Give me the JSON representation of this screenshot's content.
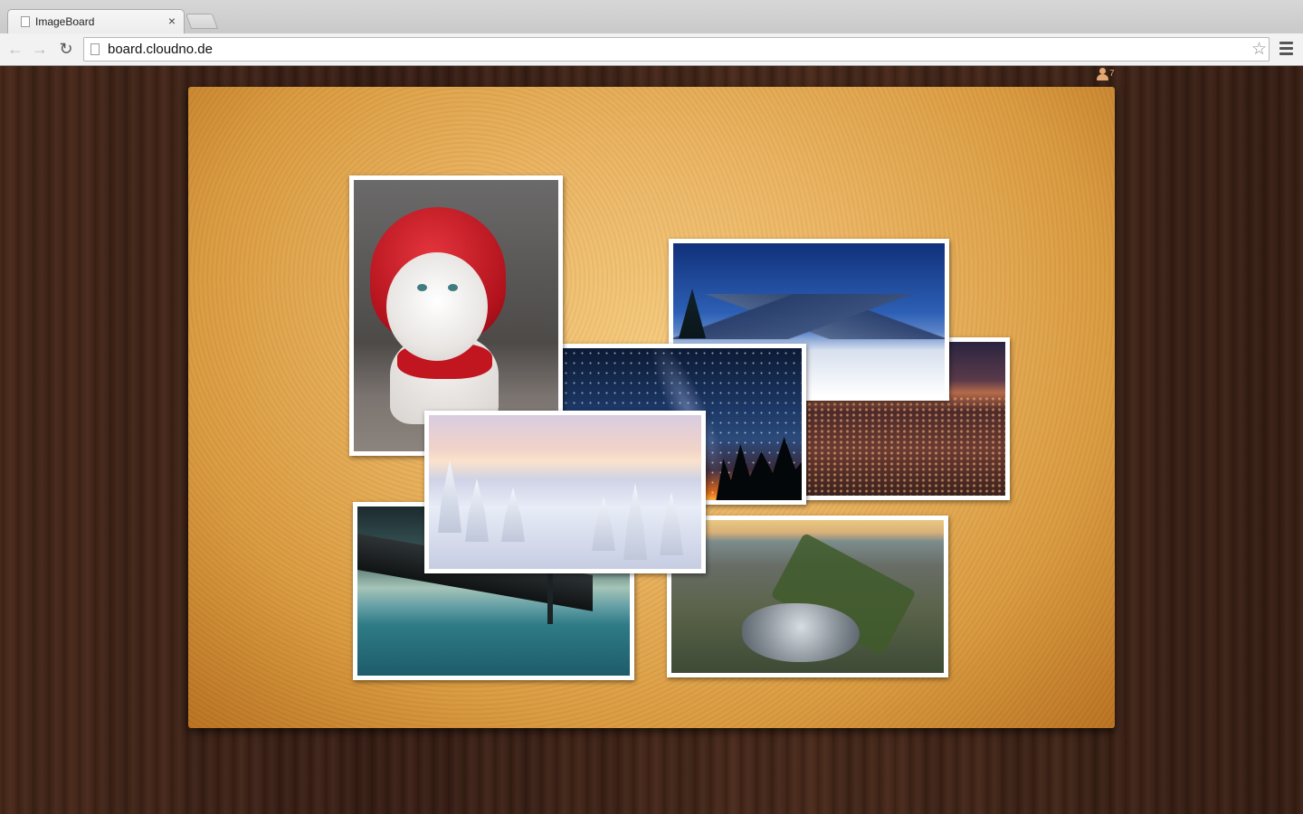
{
  "browser": {
    "tab_title": "ImageBoard",
    "tab_close": "×",
    "url": "board.cloudno.de",
    "icons": {
      "back": "back-arrow-icon",
      "forward": "forward-arrow-icon",
      "reload": "reload-icon",
      "bookmark": "star-icon",
      "menu": "hamburger-menu-icon"
    }
  },
  "board": {
    "users_online": "7",
    "background_color": "#e9b25f",
    "photos": [
      {
        "name": "cat-in-red-hood",
        "subject": "white cat wearing red hood"
      },
      {
        "name": "snowy-mountains",
        "subject": "snowy mountain range under blue sky"
      },
      {
        "name": "city-at-dusk",
        "subject": "city lights at dusk"
      },
      {
        "name": "milky-way",
        "subject": "night sky with trees silhouette"
      },
      {
        "name": "snowy-forest",
        "subject": "snow-covered trees at sunrise"
      },
      {
        "name": "suspension-bridge",
        "subject": "suspension bridge over sea"
      },
      {
        "name": "central-park",
        "subject": "aerial view of city park with lake"
      }
    ]
  }
}
